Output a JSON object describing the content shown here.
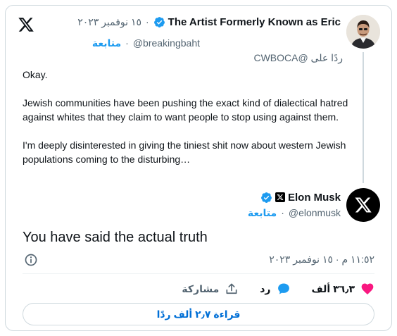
{
  "parent": {
    "author_name": "The Artist Formerly Known as Eric",
    "date": "١٥ نوفمبر ٢٠٢٣",
    "handle": "@breakingbaht",
    "follow_label": "متابعة",
    "reply_to": "ردًا على @CWBOCA",
    "paragraphs": [
      "Okay.",
      "Jewish communities have been pushing the exact kind of dialectical hatred against whites that they claim to want people to stop using against them.",
      "I'm deeply disinterested in giving the tiniest shit now about western Jewish populations coming to the disturbing…"
    ]
  },
  "tweet": {
    "author_name": "Elon Musk",
    "handle": "@elonmusk",
    "follow_label": "متابعة",
    "text": "You have said the actual truth",
    "timestamp": "١١:٥٢ م · ١٥ نوفمبر ٢٠٢٣"
  },
  "actions": {
    "likes": "٣٦٫٣ ألف",
    "reply_label": "رد",
    "share_label": "مشاركة"
  },
  "read_replies_label": "قراءة ٢٫٧ ألف ردًا",
  "icons": {
    "logo": "x-logo-icon",
    "verified": "verified-badge-icon",
    "info": "info-icon",
    "like": "heart-icon",
    "reply": "speech-bubble-icon",
    "share": "share-arrow-icon"
  },
  "colors": {
    "accent": "#1d9bf0",
    "like": "#f91880",
    "text": "#0f1419",
    "muted": "#536471",
    "border": "#cfd9de"
  }
}
